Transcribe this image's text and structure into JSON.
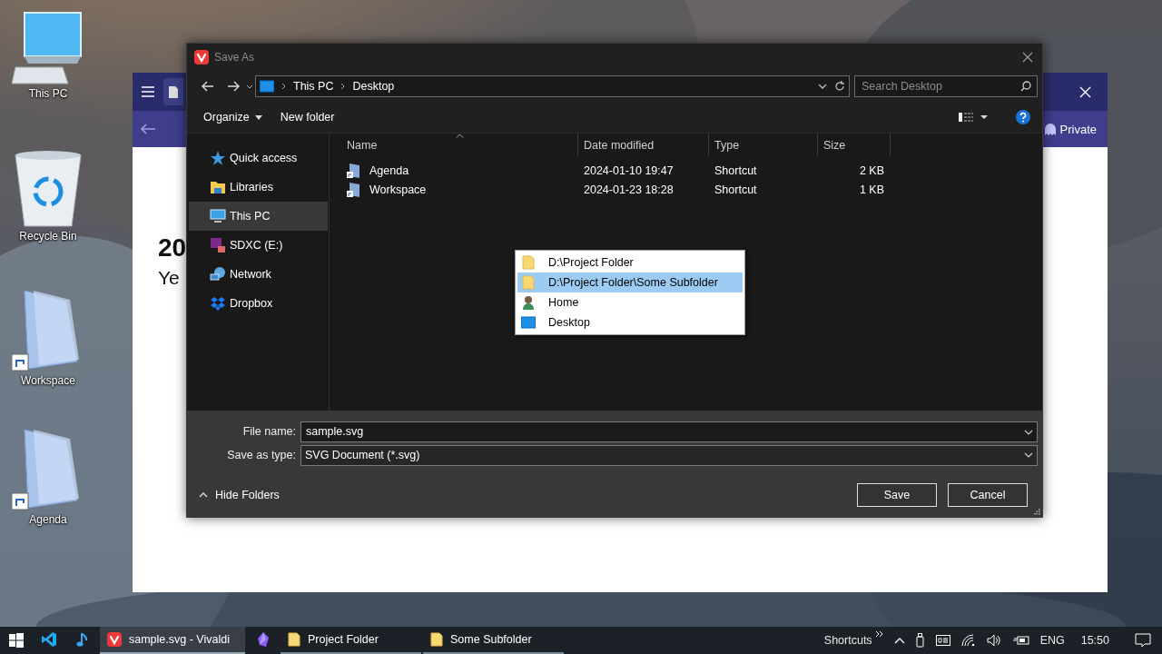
{
  "desktop_icons": [
    {
      "label": "This PC",
      "kind": "pc"
    },
    {
      "label": "Recycle Bin",
      "kind": "bin"
    },
    {
      "label": "Workspace",
      "kind": "shortcut"
    },
    {
      "label": "Agenda",
      "kind": "shortcut"
    }
  ],
  "browser": {
    "heading": "20",
    "subheading": "Ye",
    "private_label": "Private"
  },
  "dialog": {
    "title": "Save As",
    "breadcrumb": [
      "This PC",
      "Desktop"
    ],
    "search": {
      "placeholder": "Search Desktop"
    },
    "toolbar": [
      "Organize",
      "New folder"
    ],
    "nav": [
      {
        "label": "Quick access",
        "kind": "star",
        "selected": false
      },
      {
        "label": "Libraries",
        "kind": "library",
        "selected": false
      },
      {
        "label": "This PC",
        "kind": "pc",
        "selected": true
      },
      {
        "label": "SDXC (E:)",
        "kind": "sd",
        "selected": false
      },
      {
        "label": "Network",
        "kind": "network",
        "selected": false
      },
      {
        "label": "Dropbox",
        "kind": "dropbox",
        "selected": false
      }
    ],
    "columns": [
      "Name",
      "Date modified",
      "Type",
      "Size"
    ],
    "files": [
      {
        "name": "Agenda",
        "date": "2024-01-10 19:47",
        "type": "Shortcut",
        "size": "2 KB"
      },
      {
        "name": "Workspace",
        "date": "2024-01-23 18:28",
        "type": "Shortcut",
        "size": "1 KB"
      }
    ],
    "dropdown": [
      {
        "label": "D:\\Project Folder",
        "kind": "folder",
        "selected": false
      },
      {
        "label": "D:\\Project Folder\\Some Subfolder",
        "kind": "folder",
        "selected": true
      },
      {
        "label": "Home",
        "kind": "user",
        "selected": false
      },
      {
        "label": "Desktop",
        "kind": "desktop",
        "selected": false
      }
    ],
    "file_name": {
      "label": "File name:",
      "value": "sample.svg"
    },
    "save_type": {
      "label": "Save as type:",
      "value": "SVG Document (*.svg)"
    },
    "hide_folders": "Hide Folders",
    "buttons": [
      "Save",
      "Cancel"
    ]
  },
  "taskbar": {
    "apps": [
      {
        "kind": "code",
        "active": false,
        "running": false
      },
      {
        "kind": "music",
        "active": false,
        "running": false
      },
      {
        "label": "sample.svg - Vivaldi",
        "kind": "vivaldi",
        "active": true,
        "running": true
      },
      {
        "kind": "obsidian",
        "active": false,
        "running": false
      },
      {
        "label": "Project Folder",
        "kind": "folder",
        "active": false,
        "running": true
      },
      {
        "label": "Some Subfolder",
        "kind": "folder",
        "active": false,
        "running": true
      }
    ],
    "shortcuts": "Shortcuts",
    "language": "ENG",
    "time": "15:50"
  }
}
